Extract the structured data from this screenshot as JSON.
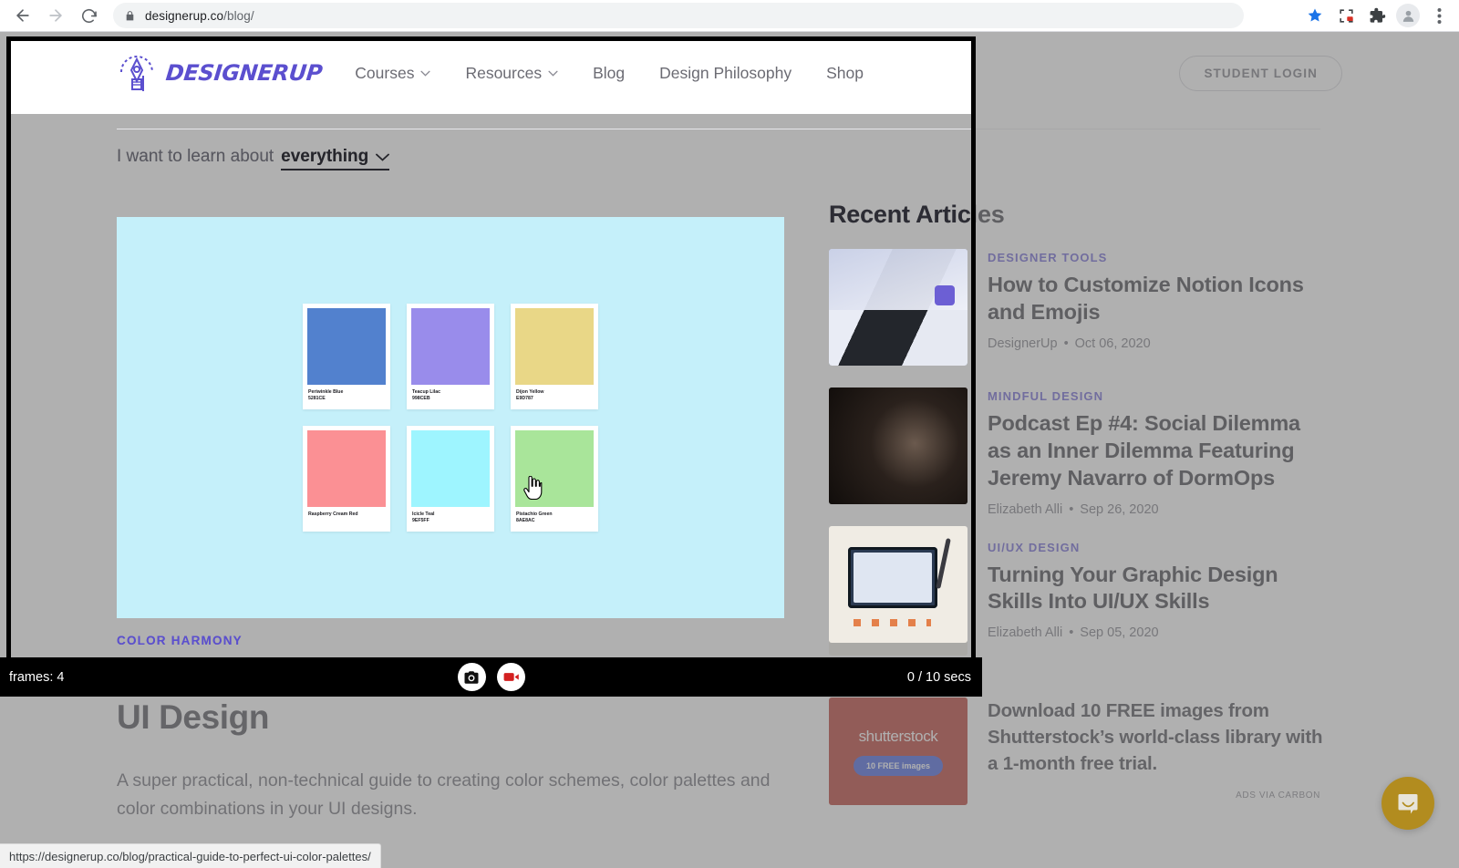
{
  "browser": {
    "url_display": "designerup.co/blog/",
    "url_scheme_host": "designerup.co",
    "url_path": "/blog/",
    "back_icon": "back-arrow-icon",
    "forward_icon": "forward-arrow-icon",
    "reload_icon": "reload-icon",
    "lock_icon": "lock-icon",
    "bookmark_icon": "star-filled-icon",
    "capture_icon": "screen-capture-icon",
    "extensions_icon": "puzzle-piece-icon",
    "profile_icon": "profile-avatar-icon",
    "menu_icon": "three-dot-menu-icon",
    "status_url": "https://designerup.co/blog/practical-guide-to-perfect-ui-color-palettes/"
  },
  "site": {
    "logo_text": "DESIGNERUP",
    "nav": [
      {
        "label": "Courses",
        "has_caret": true
      },
      {
        "label": "Resources",
        "has_caret": true
      },
      {
        "label": "Blog",
        "has_caret": false
      },
      {
        "label": "Design Philosophy",
        "has_caret": false
      },
      {
        "label": "Shop",
        "has_caret": false
      }
    ],
    "student_login": "STUDENT LOGIN"
  },
  "filter": {
    "prefix": "I want to learn about",
    "value": "everything",
    "caret_icon": "chevron-down-icon"
  },
  "feature": {
    "category": "COLOR HARMONY",
    "title": "Color Theory and Perfect Color Palettes in UI Design",
    "description": "A super practical, non-technical guide to creating color schemes, color palettes and color combinations in your UI designs.",
    "hero_bg": "#c5f0fa",
    "swatches": [
      {
        "name": "Periwinkle Blue",
        "hex_label": "5281CE",
        "color": "#5281ce"
      },
      {
        "name": "Teacup Lilac",
        "hex_label": "998CEB",
        "color": "#998ceb"
      },
      {
        "name": "Dijon Yellow",
        "hex_label": "E9D787",
        "color": "#e9d787"
      },
      {
        "name": "Raspberry Cream Red",
        "hex_label": "FF9093",
        "color": "#fb9094"
      },
      {
        "name": "Icicle Teal",
        "hex_label": "9EF5FF",
        "color": "#9ef5ff"
      },
      {
        "name": "Pistachio Green",
        "hex_label": "8AE8AC",
        "color": "#a9e59a"
      }
    ]
  },
  "sidebar": {
    "title": "Recent Articles",
    "articles": [
      {
        "category": "DESIGNER TOOLS",
        "title": "How to Customize Notion Icons and Emojis",
        "author": "DesignerUp",
        "date": "Oct 06, 2020",
        "thumb": "notion-templates-thumbnail"
      },
      {
        "category": "MINDFUL DESIGN",
        "title": "Podcast Ep #4: Social Dilemma as an Inner Dilemma Featuring Jeremy Navarro of DormOps",
        "author": "Elizabeth Alli",
        "date": "Sep 26, 2020",
        "thumb": "dark-hands-thumbnail"
      },
      {
        "category": "UI/UX DESIGN",
        "title": "Turning Your Graphic Design Skills Into UI/UX Skills",
        "author": "Elizabeth Alli",
        "date": "Sep 05, 2020",
        "thumb": "tablet-workspace-thumbnail"
      }
    ]
  },
  "ad": {
    "brand": "shutterstock",
    "pill": "10 FREE images",
    "text": "Download 10 FREE images from Shutterstock’s world-class library with a 1-month free trial.",
    "via": "ADS VIA CARBON"
  },
  "recorder": {
    "frames_label": "frames: 4",
    "time_label": "0 / 10 secs",
    "camera_icon": "camera-icon",
    "video_icon": "video-camera-icon"
  },
  "chat": {
    "icon": "intercom-chat-icon",
    "accent": "#b28c1f"
  },
  "cursor": {
    "icon": "pointing-hand-cursor-icon"
  }
}
